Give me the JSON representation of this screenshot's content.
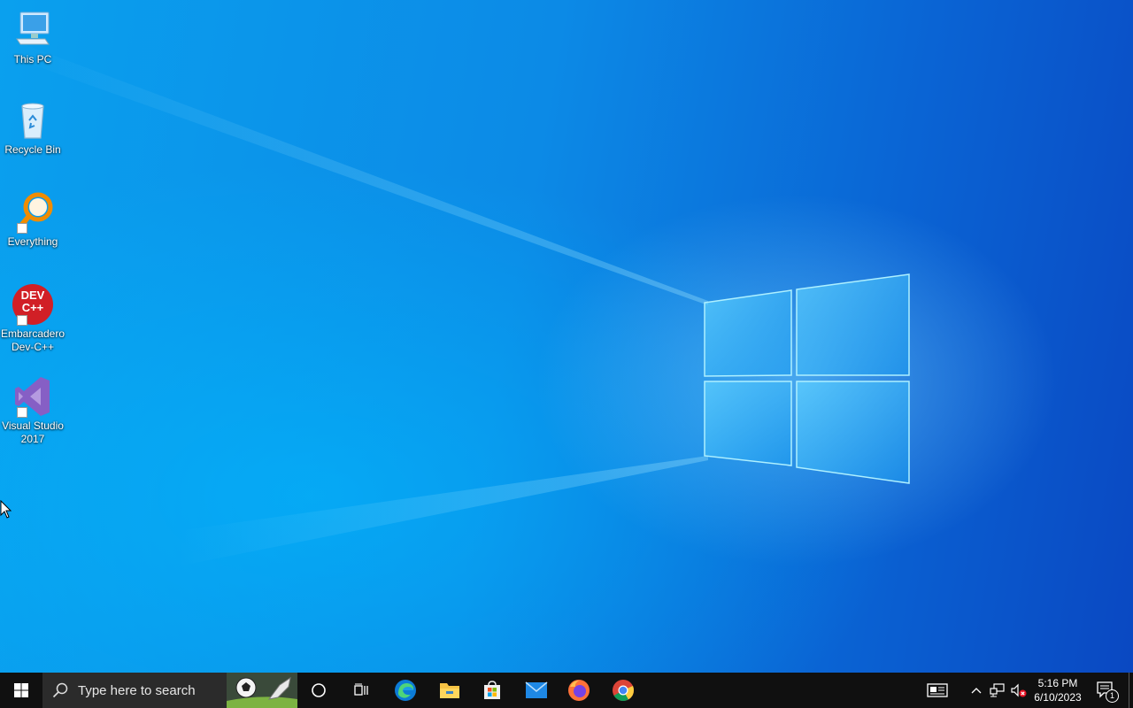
{
  "desktop": {
    "icons": [
      {
        "label": "This PC",
        "icon": "computer-icon"
      },
      {
        "label": "Recycle Bin",
        "icon": "recycle-bin-icon"
      },
      {
        "label": "Everything",
        "icon": "everything-search-icon"
      },
      {
        "label": "Embarcadero\nDev-C++",
        "icon": "devcpp-icon",
        "badge": "DEV\nC++"
      },
      {
        "label": "Visual Studio\n2017",
        "icon": "visual-studio-icon"
      }
    ]
  },
  "taskbar": {
    "search_placeholder": "Type here to search",
    "pinned": [
      "cortana-icon",
      "task-view-icon",
      "edge-icon",
      "file-explorer-icon",
      "store-icon",
      "mail-icon",
      "firefox-icon",
      "chrome-icon"
    ],
    "tray": {
      "icons": [
        "news-icon",
        "chevron-up-icon",
        "network-icon",
        "volume-muted-icon"
      ],
      "time": "5:16 PM",
      "date": "6/10/2023",
      "notification_count": "1"
    }
  },
  "colors": {
    "taskbar_bg": "#101010",
    "search_bg": "#2b2b2b",
    "wallpaper_blue": "#0a8ae6"
  }
}
